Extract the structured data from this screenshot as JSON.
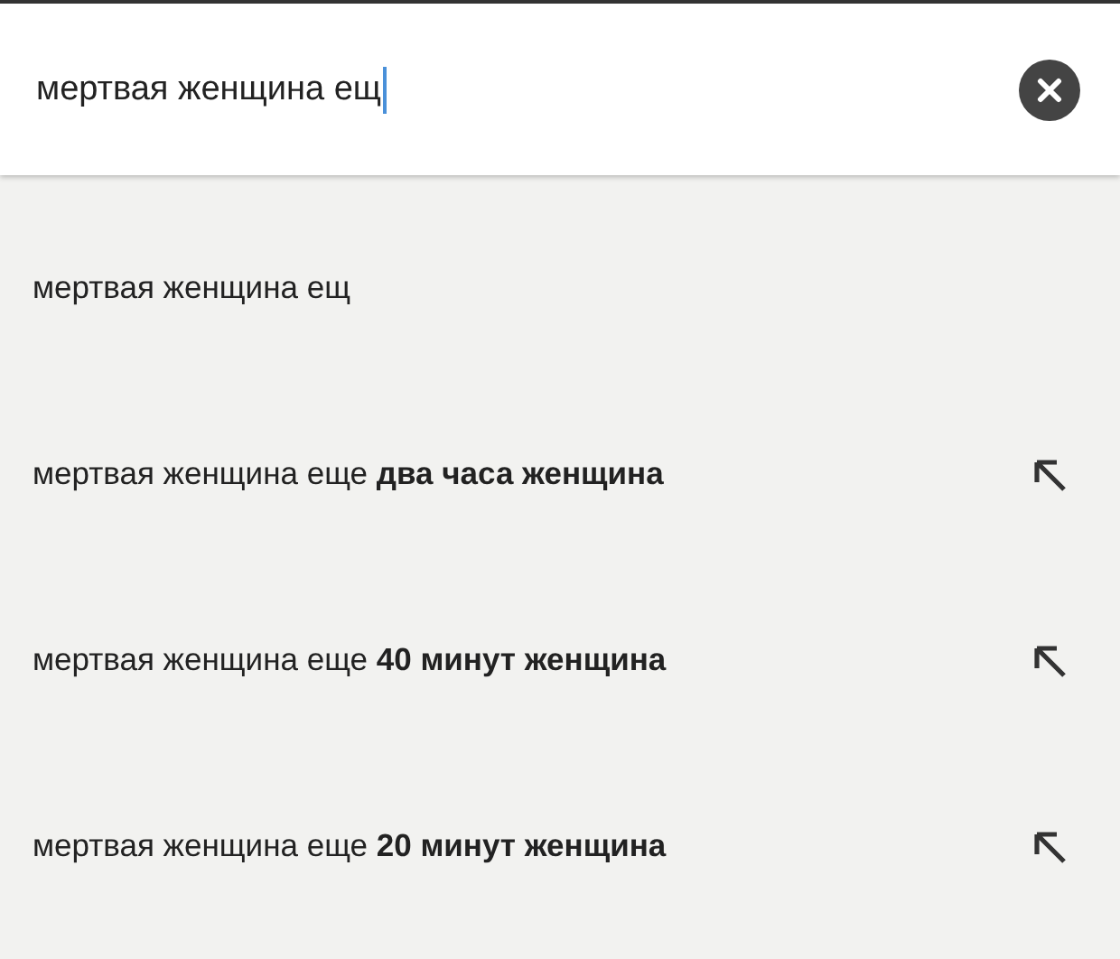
{
  "search": {
    "value": "мертвая женщина ещ"
  },
  "suggestions": [
    {
      "text": "мертвая женщина ещ",
      "kind": "typed"
    },
    {
      "text": "мертвая женщина еще **два часа женщина**",
      "kind": "completion"
    },
    {
      "text": "мертвая женщина еще **40 минут женщина**",
      "kind": "completion"
    },
    {
      "text": "мертвая женщина еще **20 минут женщина**",
      "kind": "completion"
    }
  ]
}
